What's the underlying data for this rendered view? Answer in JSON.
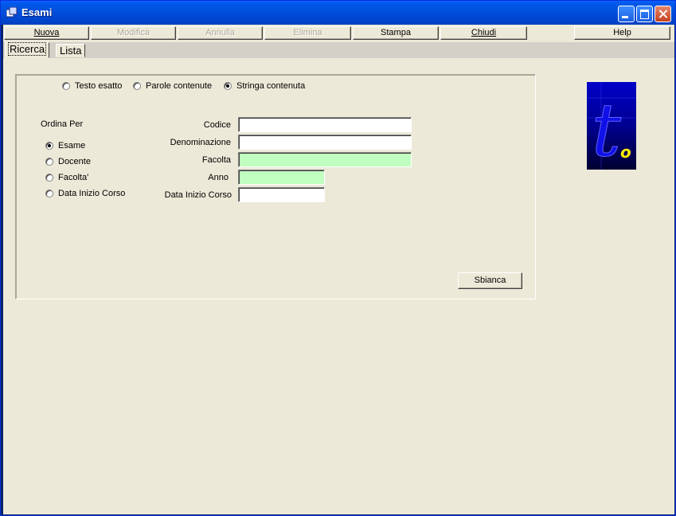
{
  "window": {
    "title": "Esami"
  },
  "toolbar": {
    "buttons": [
      {
        "label": "Nuova",
        "enabled": true
      },
      {
        "label": "Modifica",
        "enabled": false
      },
      {
        "label": "Annulla",
        "enabled": false
      },
      {
        "label": "Elimina",
        "enabled": false
      },
      {
        "label": "Stampa",
        "enabled": true
      },
      {
        "label": "Chiudi",
        "enabled": true
      },
      {
        "label": "Help",
        "enabled": true
      }
    ]
  },
  "tabs": [
    {
      "label": "Ricerca",
      "active": true
    },
    {
      "label": "Lista",
      "active": false
    }
  ],
  "search_mode": {
    "options": [
      "Testo esatto",
      "Parole contenute",
      "Stringa contenuta"
    ],
    "selected": "Stringa contenuta"
  },
  "order_by": {
    "label": "Ordina Per",
    "options": [
      "Esame",
      "Docente",
      "Facolta'",
      "Data Inizio Corso"
    ],
    "selected": "Esame"
  },
  "fields": [
    {
      "label": "Codice",
      "value": "",
      "highlight": false
    },
    {
      "label": "Denominazione",
      "value": "",
      "highlight": false
    },
    {
      "label": "Facolta",
      "value": "",
      "highlight": true
    },
    {
      "label": "Anno",
      "value": "",
      "highlight": true
    },
    {
      "label": "Data Inizio Corso",
      "value": "",
      "highlight": false
    }
  ],
  "reset_button": {
    "label": "Sbianca"
  },
  "logo": {
    "letters": [
      "t",
      "o"
    ],
    "colors": {
      "top": "#0000c8",
      "bottom": "#000030",
      "accent": "#ffee00"
    }
  },
  "colors": {
    "titlebar": "#0058e6",
    "surface": "#ece9d8",
    "highlight_field": "#c0ffc0"
  }
}
